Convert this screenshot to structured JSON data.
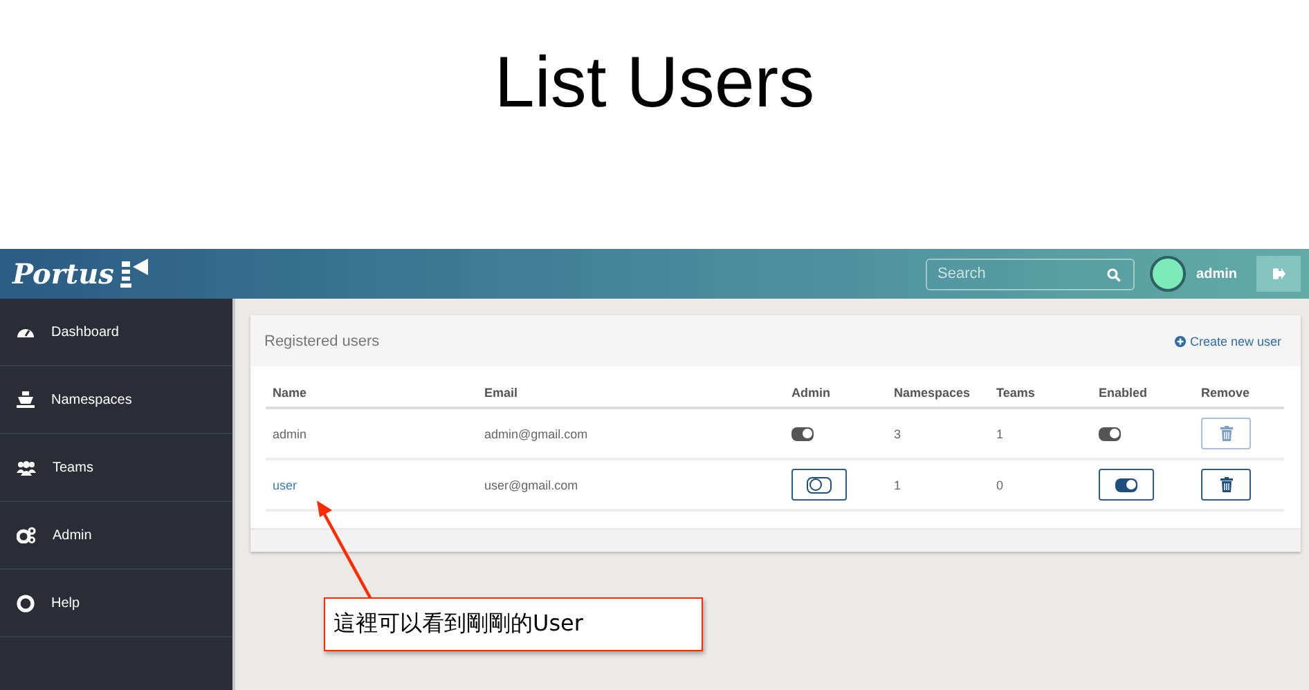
{
  "slide_title": "List Users",
  "brand": "Portus",
  "search": {
    "placeholder": "Search"
  },
  "user_menu": {
    "name": "admin"
  },
  "sidebar": {
    "items": [
      {
        "label": "Dashboard"
      },
      {
        "label": "Namespaces"
      },
      {
        "label": "Teams"
      },
      {
        "label": "Admin"
      },
      {
        "label": "Help"
      }
    ]
  },
  "panel": {
    "title": "Registered users",
    "action": "Create new user"
  },
  "table": {
    "columns": [
      "Name",
      "Email",
      "Admin",
      "Namespaces",
      "Teams",
      "Enabled",
      "Remove"
    ],
    "rows": [
      {
        "name": "admin",
        "email": "admin@gmail.com",
        "admin": true,
        "namespaces": "3",
        "teams": "1",
        "enabled": true,
        "disabled": true
      },
      {
        "name": "user",
        "email": "user@gmail.com",
        "admin": false,
        "namespaces": "1",
        "teams": "0",
        "enabled": true,
        "disabled": false
      }
    ]
  },
  "callout": {
    "text": "這裡可以看到剛剛的User"
  }
}
